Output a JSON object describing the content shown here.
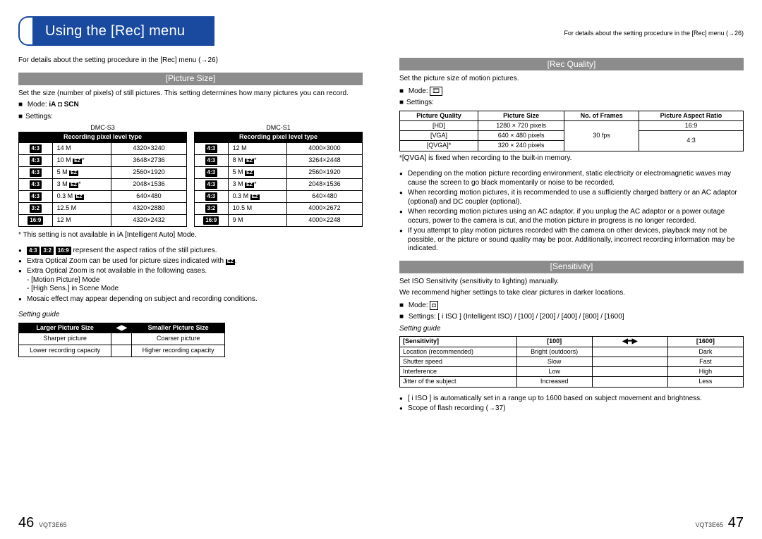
{
  "chapter_title": "Using the [Rec] menu",
  "details_ref": "For details about the setting procedure in the [Rec] menu (→26)",
  "picture_size": {
    "heading": "[Picture Size]",
    "desc": "Set the size (number of pixels) of still pictures. This setting determines how many pictures you can record.",
    "mode_label": "Mode:",
    "mode_icons_text": "iA ◘ SCN",
    "settings_label": "Settings:",
    "tbl_header": "Recording pixel level type",
    "models": {
      "left": "DMC-S3",
      "right": "DMC-S1"
    },
    "left_rows": [
      {
        "ar": "4:3",
        "label": "14 M",
        "res": "4320×3240"
      },
      {
        "ar": "4:3",
        "label": "10 M EZ*",
        "res": "3648×2736",
        "ez": true
      },
      {
        "ar": "4:3",
        "label": "5 M EZ",
        "res": "2560×1920",
        "ez": true
      },
      {
        "ar": "4:3",
        "label": "3 M EZ*",
        "res": "2048×1536",
        "ez": true
      },
      {
        "ar": "4:3",
        "label": "0.3 M EZ",
        "res": "640×480",
        "ez": true
      },
      {
        "ar": "3:2",
        "label": "12.5 M",
        "res": "4320×2880"
      },
      {
        "ar": "16:9",
        "label": "12 M",
        "res": "4320×2432"
      }
    ],
    "right_rows": [
      {
        "ar": "4:3",
        "label": "12 M",
        "res": "4000×3000"
      },
      {
        "ar": "4:3",
        "label": "8 M EZ*",
        "res": "3264×2448",
        "ez": true
      },
      {
        "ar": "4:3",
        "label": "5 M EZ",
        "res": "2560×1920",
        "ez": true
      },
      {
        "ar": "4:3",
        "label": "3 M EZ*",
        "res": "2048×1536",
        "ez": true
      },
      {
        "ar": "4:3",
        "label": "0.3 M EZ",
        "res": "640×480",
        "ez": true
      },
      {
        "ar": "3:2",
        "label": "10.5 M",
        "res": "4000×2672"
      },
      {
        "ar": "16:9",
        "label": "9 M",
        "res": "4000×2248"
      }
    ],
    "star_note": "* This setting is not available in iA [Intelligent Auto] Mode.",
    "notes": [
      "4:3  3:2  16:9 represent the aspect ratios of the still pictures.",
      "Extra Optical Zoom can be used for picture sizes indicated with EZ.",
      "Extra Optical Zoom is not available in the following cases.\n    - [Motion Picture] Mode\n    - [High Sens.] in Scene Mode",
      "Mosaic effect may appear depending on subject and recording conditions."
    ],
    "guide_title": "Setting guide",
    "guide_cols": {
      "left": "Larger Picture Size",
      "right": "Smaller Picture Size"
    },
    "guide_rows": [
      {
        "l": "Sharper picture",
        "r": "Coarser picture"
      },
      {
        "l": "Lower recording capacity",
        "r": "Higher recording capacity"
      }
    ]
  },
  "rec_quality": {
    "heading": "[Rec Quality]",
    "desc": "Set the picture size of motion pictures.",
    "mode_label": "Mode:",
    "mode_icon_text": "🎞",
    "settings_label": "Settings:",
    "cols": [
      "Picture Quality",
      "Picture Size",
      "No. of Frames",
      "Picture Aspect Ratio"
    ],
    "rows": [
      {
        "q": "[HD]",
        "s": "1280 × 720 pixels",
        "fps": "",
        "ar": "16:9"
      },
      {
        "q": "[VGA]",
        "s": "640 × 480 pixels",
        "fps": "30 fps",
        "ar": "4:3"
      },
      {
        "q": "[QVGA]*",
        "s": "320 × 240 pixels",
        "fps": "",
        "ar": ""
      }
    ],
    "star": "*[QVGA] is fixed when recording to the built-in memory.",
    "notes": [
      "Depending on the motion picture recording environment, static electricity or electromagnetic waves may cause the screen to go black momentarily or noise to be recorded.",
      "When recording motion pictures, it is recommended to use a sufficiently charged battery or an AC adaptor (optional) and DC coupler (optional).",
      "When recording motion pictures using an AC adaptor, if you unplug the AC adaptor or a power outage occurs, power to the camera is cut, and the motion picture in progress is no longer recorded.",
      "If you attempt to play motion pictures recorded with the camera on other devices, playback may not be possible, or the picture or sound quality may be poor. Additionally, incorrect recording information may be indicated."
    ]
  },
  "sensitivity": {
    "heading": "[Sensitivity]",
    "desc": "Set ISO Sensitivity (sensitivity to lighting) manually.",
    "rec": "We recommend higher settings to take clear pictures in darker locations.",
    "mode_label": "Mode:",
    "mode_icon_text": "◘",
    "settings_label": "Settings:",
    "settings_value": "[ i ISO ] (Intelligent ISO) / [100] / [200] / [400] / [800] / [1600]",
    "guide_title": "Setting guide",
    "guide_head": [
      "[Sensitivity]",
      "[100]",
      "[1600]"
    ],
    "guide_rows": [
      {
        "a": "Location (recommended)",
        "b": "Bright (outdoors)",
        "c": "Dark"
      },
      {
        "a": "Shutter speed",
        "b": "Slow",
        "c": "Fast"
      },
      {
        "a": "Interference",
        "b": "Low",
        "c": "High"
      },
      {
        "a": "Jitter of the subject",
        "b": "Increased",
        "c": "Less"
      }
    ],
    "notes": [
      "[ i ISO ] is automatically set in a range up to 1600 based on subject movement and brightness.",
      "Scope of flash recording (→37)"
    ]
  },
  "footer": {
    "manual_id": "VQT3E65",
    "left_page": "46",
    "right_page": "47"
  }
}
